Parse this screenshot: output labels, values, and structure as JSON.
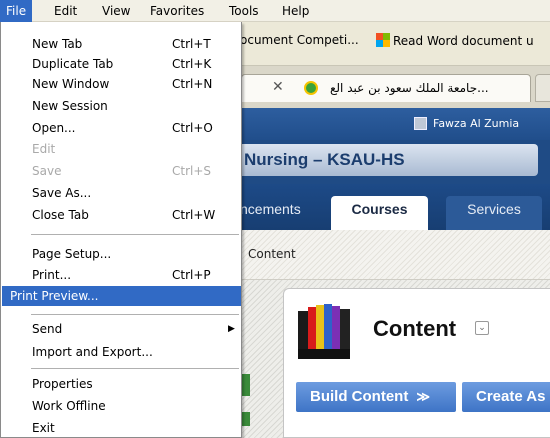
{
  "menubar": {
    "items": [
      {
        "label": "File",
        "active": true
      },
      {
        "label": "Edit"
      },
      {
        "label": "View"
      },
      {
        "label": "Favorites"
      },
      {
        "label": "Tools"
      },
      {
        "label": "Help"
      }
    ]
  },
  "favorites_bar": {
    "item1": "ocument Competi...",
    "item2": "Read Word document u"
  },
  "browser_tab": {
    "title": "...جامعة الملك سعود بن عبد الع"
  },
  "site": {
    "user_name": "Fawza Al Zumia",
    "brand_title": "Nursing – KSAU-HS",
    "nav_tabs": [
      "ncements",
      "Courses",
      "Services"
    ],
    "breadcrumb": "Content",
    "content_heading": "Content",
    "build_button": "Build Content",
    "create_button": "Create As"
  },
  "file_menu": {
    "items": [
      {
        "label": "New Tab",
        "shortcut": "Ctrl+T"
      },
      {
        "label": "Duplicate Tab",
        "shortcut": "Ctrl+K"
      },
      {
        "label": "New Window",
        "shortcut": "Ctrl+N"
      },
      {
        "label": "New Session",
        "shortcut": ""
      },
      {
        "label": "Open...",
        "shortcut": "Ctrl+O"
      },
      {
        "label": "Edit",
        "shortcut": "",
        "disabled": true
      },
      {
        "label": "Save",
        "shortcut": "Ctrl+S",
        "disabled": true
      },
      {
        "label": "Save As...",
        "shortcut": ""
      },
      {
        "label": "Close Tab",
        "shortcut": "Ctrl+W"
      },
      {
        "label": "Page Setup...",
        "shortcut": ""
      },
      {
        "label": "Print...",
        "shortcut": "Ctrl+P"
      },
      {
        "label": "Print Preview...",
        "shortcut": "",
        "highlighted": true
      },
      {
        "label": "Send",
        "shortcut": "",
        "submenu": true
      },
      {
        "label": "Import and Export...",
        "shortcut": ""
      },
      {
        "label": "Properties",
        "shortcut": ""
      },
      {
        "label": "Work Offline",
        "shortcut": ""
      },
      {
        "label": "Exit",
        "shortcut": ""
      }
    ]
  },
  "colors": {
    "highlight": "#316ac5",
    "site_header": "#1f4b85",
    "button_blue": "#4a80cf"
  }
}
